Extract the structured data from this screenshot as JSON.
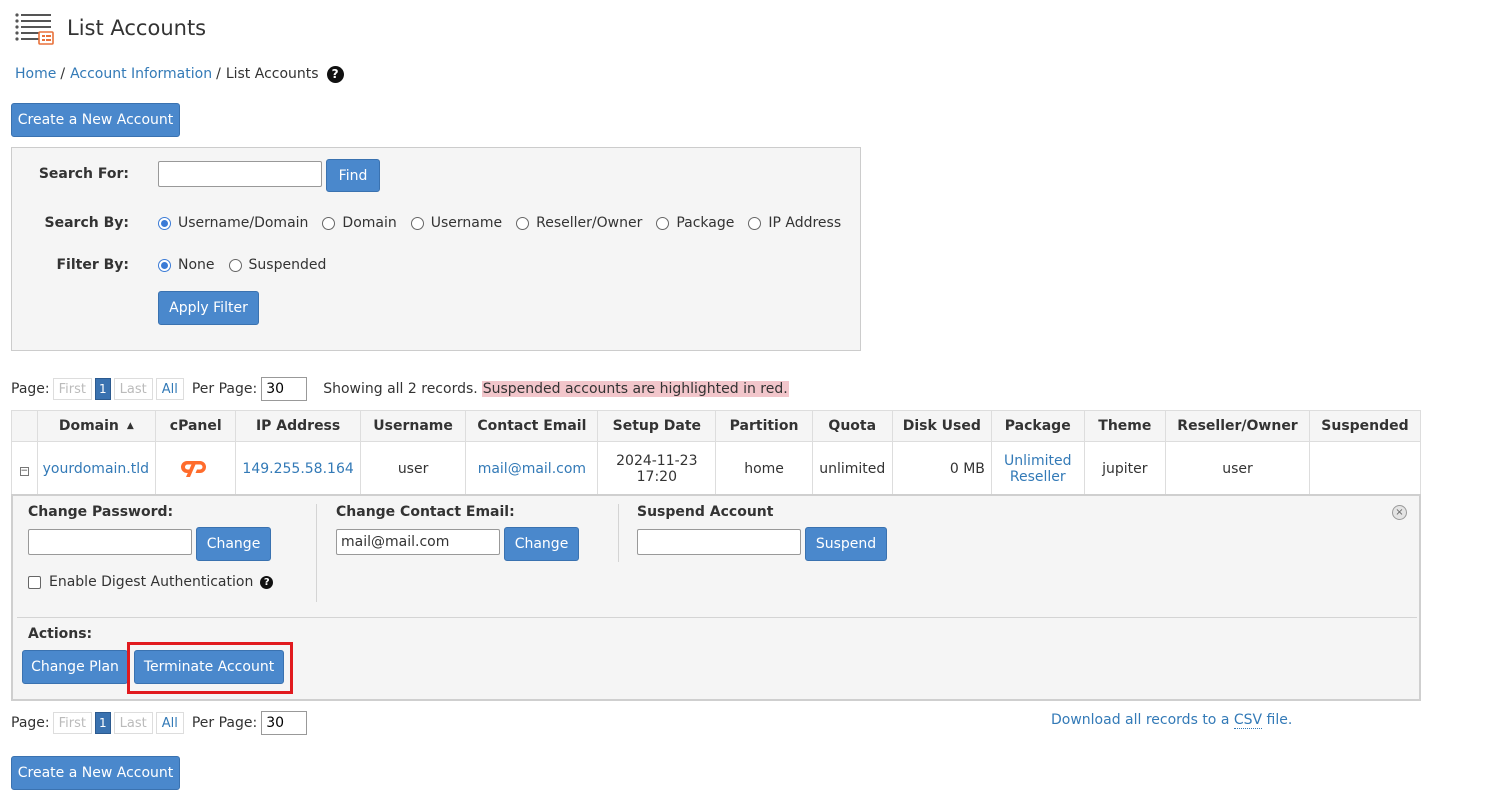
{
  "header": {
    "title": "List Accounts",
    "icon": "list-accounts-icon"
  },
  "breadcrumb": {
    "home": "Home",
    "account_info": "Account Information",
    "current": "List Accounts",
    "help": "?"
  },
  "buttons": {
    "create_account": "Create a New Account",
    "find": "Find",
    "apply_filter": "Apply Filter"
  },
  "search": {
    "search_for_label": "Search For:",
    "search_for_value": "",
    "search_by_label": "Search By:",
    "search_by_options": [
      "Username/Domain",
      "Domain",
      "Username",
      "Reseller/Owner",
      "Package",
      "IP Address"
    ],
    "search_by_selected": "Username/Domain",
    "filter_by_label": "Filter By:",
    "filter_by_options": [
      "None",
      "Suspended"
    ],
    "filter_by_selected": "None"
  },
  "pagination": {
    "page_label": "Page:",
    "first": "First",
    "current": "1",
    "last": "Last",
    "all": "All",
    "per_page_label": "Per Page:",
    "per_page_value": "30",
    "records_text": "Showing all 2 records.",
    "suspended_note": "Suspended accounts are highlighted in red."
  },
  "table": {
    "columns": [
      "Domain",
      "cPanel",
      "IP Address",
      "Username",
      "Contact Email",
      "Setup Date",
      "Partition",
      "Quota",
      "Disk Used",
      "Package",
      "Theme",
      "Reseller/Owner",
      "Suspended"
    ],
    "rows": [
      {
        "expand": "−",
        "domain": "yourdomain.tld",
        "ip": "149.255.58.164",
        "username": "user",
        "email": "mail@mail.com",
        "setup_date": "2024-11-23 17:20",
        "partition": "home",
        "quota": "unlimited",
        "disk_used": "0 MB",
        "package_line1": "Unlimited",
        "package_line2": "Reseller",
        "theme": "jupiter",
        "owner": "user",
        "suspended": ""
      }
    ]
  },
  "details": {
    "change_password_label": "Change Password:",
    "change_password_value": "",
    "change_button": "Change",
    "digest_label": "Enable Digest Authentication",
    "change_email_label": "Change Contact Email:",
    "change_email_value": "mail@mail.com",
    "suspend_label": "Suspend Account",
    "suspend_value": "",
    "suspend_button": "Suspend",
    "actions_label": "Actions:",
    "change_plan": "Change Plan",
    "terminate": "Terminate Account",
    "close": "×"
  },
  "csv": {
    "prefix": "Download all records to a ",
    "abbr": "CSV",
    "suffix": " file."
  },
  "colors": {
    "accent": "#4a88cc",
    "link": "#337ab7",
    "highlight": "#e11a1f",
    "suspended_bg": "#f2c6cb",
    "cpanel_orange": "#ff6c2c"
  }
}
